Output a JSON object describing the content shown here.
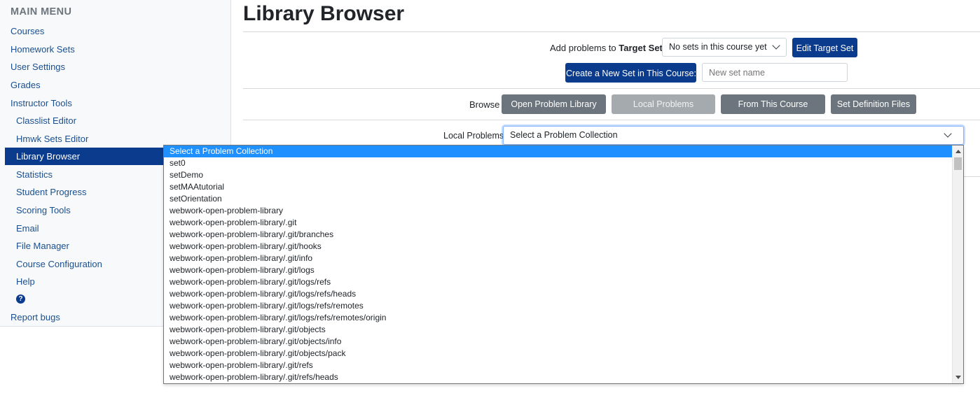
{
  "sidebar": {
    "heading": "MAIN MENU",
    "items": [
      {
        "label": "Courses"
      },
      {
        "label": "Homework Sets"
      },
      {
        "label": "User Settings"
      },
      {
        "label": "Grades"
      },
      {
        "label": "Instructor Tools"
      },
      {
        "label": "Classlist Editor"
      },
      {
        "label": "Hmwk Sets Editor"
      },
      {
        "label": "Library Browser"
      },
      {
        "label": "Statistics"
      },
      {
        "label": "Student Progress"
      },
      {
        "label": "Scoring Tools"
      },
      {
        "label": "Email"
      },
      {
        "label": "File Manager"
      },
      {
        "label": "Course Configuration"
      },
      {
        "label": "Help"
      },
      {
        "label": "Report bugs"
      }
    ],
    "help_icon": "question-circle-icon",
    "help_glyph": "?",
    "active_item": "Library Browser"
  },
  "page": {
    "title": "Library Browser"
  },
  "target": {
    "label_prefix": "Add problems to ",
    "label_bold": "Target Set:",
    "select_value": "No sets in this course yet",
    "edit_button": "Edit Target Set",
    "create_button": "Create a New Set in This Course:",
    "new_set_placeholder": "New set name"
  },
  "browse": {
    "label": "Browse",
    "buttons": [
      {
        "label": "Open Problem Library",
        "state": "enabled"
      },
      {
        "label": "Local Problems",
        "state": "disabled"
      },
      {
        "label": "From This Course",
        "state": "enabled"
      },
      {
        "label": "Set Definition Files",
        "state": "enabled"
      }
    ]
  },
  "local_problems": {
    "label": "Local Problems:",
    "select_value": "Select a Problem Collection",
    "options": [
      "Select a Problem Collection",
      "set0",
      "setDemo",
      "setMAAtutorial",
      "setOrientation",
      "webwork-open-problem-library",
      "webwork-open-problem-library/.git",
      "webwork-open-problem-library/.git/branches",
      "webwork-open-problem-library/.git/hooks",
      "webwork-open-problem-library/.git/info",
      "webwork-open-problem-library/.git/logs",
      "webwork-open-problem-library/.git/logs/refs",
      "webwork-open-problem-library/.git/logs/refs/heads",
      "webwork-open-problem-library/.git/logs/refs/remotes",
      "webwork-open-problem-library/.git/logs/refs/remotes/origin",
      "webwork-open-problem-library/.git/objects",
      "webwork-open-problem-library/.git/objects/info",
      "webwork-open-problem-library/.git/objects/pack",
      "webwork-open-problem-library/.git/refs",
      "webwork-open-problem-library/.git/refs/heads"
    ],
    "selected_index": 0
  },
  "colors": {
    "primary": "#0b3b8c",
    "secondary": "#6c757d",
    "highlight": "#1e90ff",
    "link": "#1a4f8f"
  }
}
